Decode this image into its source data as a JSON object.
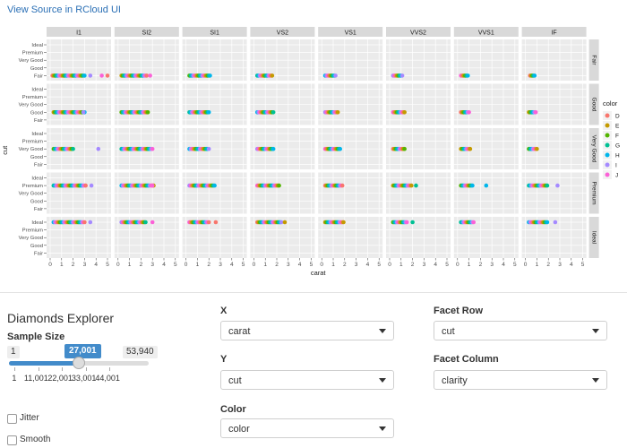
{
  "header": {
    "link_text": "View Source in RCloud UI"
  },
  "chart_data": {
    "type": "scatter",
    "xlabel": "carat",
    "ylabel": "cut",
    "facet_columns": [
      "I1",
      "SI2",
      "SI1",
      "VS2",
      "VS1",
      "VVS2",
      "VVS1",
      "IF"
    ],
    "facet_rows": [
      "Fair",
      "Good",
      "Very Good",
      "Premium",
      "Ideal"
    ],
    "y_categories": [
      "Fair",
      "Good",
      "Very Good",
      "Premium",
      "Ideal"
    ],
    "x_ticks": [
      0,
      1,
      2,
      3,
      4,
      5
    ],
    "xlim": [
      0,
      5
    ],
    "legend": {
      "title": "color",
      "position": "right",
      "entries": [
        "D",
        "E",
        "F",
        "G",
        "H",
        "I",
        "J"
      ],
      "colors": [
        "#F8766D",
        "#C49A00",
        "#53B400",
        "#00C094",
        "#00B6EB",
        "#A58AFF",
        "#FB61D7"
      ]
    },
    "ranges": [
      [
        [
          0.2,
          3
        ],
        [
          0.3,
          2.5
        ],
        [
          0.3,
          2.1
        ],
        [
          0.3,
          1.6
        ],
        [
          0.3,
          1.2
        ],
        [
          0.3,
          1.1
        ],
        [
          0.3,
          0.9
        ],
        [
          0.4,
          0.8
        ]
      ],
      [
        [
          0.3,
          3
        ],
        [
          0.3,
          2.6
        ],
        [
          0.3,
          2.0
        ],
        [
          0.3,
          1.7
        ],
        [
          0.3,
          1.4
        ],
        [
          0.3,
          1.3
        ],
        [
          0.3,
          1.0
        ],
        [
          0.3,
          0.9
        ]
      ],
      [
        [
          0.3,
          2.0
        ],
        [
          0.3,
          3.0
        ],
        [
          0.3,
          2.0
        ],
        [
          0.3,
          1.7
        ],
        [
          0.3,
          1.6
        ],
        [
          0.3,
          1.3
        ],
        [
          0.3,
          1.1
        ],
        [
          0.3,
          1.0
        ]
      ],
      [
        [
          0.3,
          3.1
        ],
        [
          0.3,
          3.1
        ],
        [
          0.3,
          2.5
        ],
        [
          0.3,
          2.2
        ],
        [
          0.3,
          1.8
        ],
        [
          0.3,
          1.9
        ],
        [
          0.3,
          1.3
        ],
        [
          0.3,
          1.9
        ]
      ],
      [
        [
          0.3,
          3.0
        ],
        [
          0.3,
          2.4
        ],
        [
          0.3,
          2.0
        ],
        [
          0.3,
          2.4
        ],
        [
          0.3,
          1.9
        ],
        [
          0.3,
          1.5
        ],
        [
          0.3,
          1.4
        ],
        [
          0.3,
          1.9
        ]
      ]
    ],
    "outliers": [
      [
        [
          3.5,
          4.5,
          5.0
        ],
        [
          2.8
        ],
        [],
        [],
        [],
        [],
        [],
        []
      ],
      [
        [
          2.9
        ],
        [],
        [],
        [],
        [],
        [],
        [],
        []
      ],
      [
        [
          4.2
        ],
        [],
        [],
        [],
        [],
        [],
        [],
        []
      ],
      [
        [
          3.6
        ],
        [
          3.0
        ],
        [],
        [],
        [],
        [
          2.3
        ],
        [
          2.5
        ],
        [
          2.8
        ]
      ],
      [
        [
          3.5
        ],
        [
          3.0
        ],
        [
          2.6
        ],
        [
          2.7
        ],
        [],
        [
          2.0
        ],
        [],
        [
          2.6
        ]
      ]
    ]
  },
  "panel": {
    "title": "Diamonds Explorer",
    "sample_size": {
      "label": "Sample Size",
      "min": "1",
      "max": "53,940",
      "value": "27,001",
      "fraction": 0.5,
      "ticks": [
        "1",
        "11,001",
        "22,001",
        "33,001",
        "44,001"
      ]
    },
    "checkboxes": [
      {
        "label": "Jitter"
      },
      {
        "label": "Smooth"
      }
    ],
    "x": {
      "label": "X",
      "value": "carat"
    },
    "y": {
      "label": "Y",
      "value": "cut"
    },
    "color": {
      "label": "Color",
      "value": "color"
    },
    "facet_row": {
      "label": "Facet Row",
      "value": "cut"
    },
    "facet_col": {
      "label": "Facet Column",
      "value": "clarity"
    }
  }
}
